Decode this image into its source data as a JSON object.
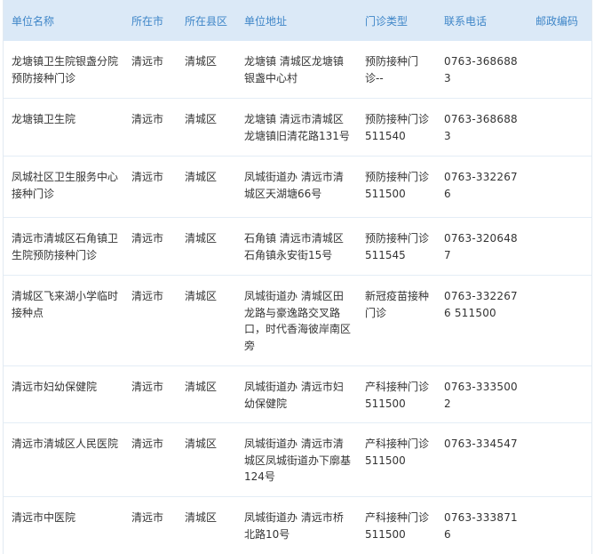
{
  "headers": {
    "name": "单位名称",
    "city": "所在市",
    "county": "所在县区",
    "address": "单位地址",
    "clinic_type": "门诊类型",
    "phone": "联系电话",
    "postal": "邮政编码"
  },
  "rows": [
    {
      "name": "龙塘镇卫生院银盏分院预防接种门诊",
      "city": "清远市",
      "county": "清城区",
      "address": "龙塘镇 清城区龙塘镇银盏中心村",
      "clinic_type": "预防接种门诊--",
      "phone": "0763-3686883",
      "postal": ""
    },
    {
      "name": "龙塘镇卫生院",
      "city": "清远市",
      "county": "清城区",
      "address": "龙塘镇 清远市清城区龙塘镇旧清花路131号",
      "clinic_type": "预防接种门诊511540",
      "phone": "0763-3686883",
      "postal": ""
    },
    {
      "name": "凤城社区卫生服务中心接种门诊",
      "city": "清远市",
      "county": "清城区",
      "address": "凤城街道办 清远市清城区天湖塘66号",
      "clinic_type": "预防接种门诊511500",
      "phone": "0763-3322676",
      "postal": ""
    },
    {
      "name": "清远市清城区石角镇卫生院预防接种门诊",
      "city": "清远市",
      "county": "清城区",
      "address": "石角镇 清远市清城区石角镇永安街15号",
      "clinic_type": "预防接种门诊511545",
      "phone": "0763-3206487",
      "postal": ""
    },
    {
      "name": "清城区飞来湖小学临时接种点",
      "city": "清远市",
      "county": "清城区",
      "address": "凤城街道办 清城区田龙路与豪逸路交叉路口，时代香海彼岸南区旁",
      "clinic_type": "新冠疫苗接种门诊",
      "phone": "0763-3322676 511500",
      "postal": ""
    },
    {
      "name": "清远市妇幼保健院",
      "city": "清远市",
      "county": "清城区",
      "address": "凤城街道办 清远市妇幼保健院",
      "clinic_type": "产科接种门诊511500",
      "phone": "0763-3335002",
      "postal": ""
    },
    {
      "name": "清远市清城区人民医院",
      "city": "清远市",
      "county": "清城区",
      "address": "凤城街道办 清远市清城区凤城街道办下廓基124号",
      "clinic_type": "产科接种门诊511500",
      "phone": "0763-334547",
      "postal": ""
    },
    {
      "name": "清远市中医院",
      "city": "清远市",
      "county": "清城区",
      "address": "凤城街道办 清远市桥北路10号",
      "clinic_type": "产科接种门诊511500",
      "phone": "0763-3338716",
      "postal": ""
    }
  ]
}
